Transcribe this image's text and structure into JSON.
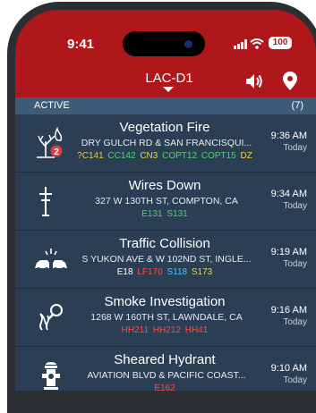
{
  "status_bar": {
    "time": "9:41",
    "battery": "100"
  },
  "header": {
    "channel": "LAC-D1"
  },
  "section": {
    "title": "ACTIVE",
    "count": "(7)"
  },
  "colors": {
    "header_red": "#b0171b",
    "list_bg": "#2a3f54",
    "section_bg": "#3e5c78"
  },
  "incidents": [
    {
      "icon": "vegetation-fire-icon",
      "badge": "2",
      "title": "Vegetation Fire",
      "address": "DRY GULCH RD & SAN FRANCISQUI...",
      "units": [
        {
          "id": "?C141",
          "color": "#f2c14e"
        },
        {
          "id": "CC142",
          "color": "#4ed36b"
        },
        {
          "id": "CN3",
          "color": "#f2d23a"
        },
        {
          "id": "COPT12",
          "color": "#4ed36b"
        },
        {
          "id": "COPT15",
          "color": "#4ed36b"
        },
        {
          "id": "DZ",
          "color": "#f2d23a"
        }
      ],
      "time": "9:36 AM",
      "day": "Today"
    },
    {
      "icon": "wires-down-icon",
      "title": "Wires Down",
      "address": "327 W 130TH ST, COMPTON, CA",
      "units": [
        {
          "id": "E131",
          "color": "#4ed36b"
        },
        {
          "id": "S131",
          "color": "#4ed36b"
        }
      ],
      "time": "9:34 AM",
      "day": "Today"
    },
    {
      "icon": "traffic-collision-icon",
      "title": "Traffic Collision",
      "address": "S YUKON AVE & W 102ND ST, INGLE...",
      "units": [
        {
          "id": "E18",
          "color": "#ffffff"
        },
        {
          "id": "LF170",
          "color": "#ff4b4b"
        },
        {
          "id": "S118",
          "color": "#4fc3f7"
        },
        {
          "id": "S173",
          "color": "#f2d23a"
        }
      ],
      "time": "9:19 AM",
      "day": "Today"
    },
    {
      "icon": "smoke-investigation-icon",
      "title": "Smoke Investigation",
      "address": "1268 W 160TH ST, LAWNDALE, CA",
      "units": [
        {
          "id": "HH211",
          "color": "#ff4b4b"
        },
        {
          "id": "HH212",
          "color": "#ff4b4b"
        },
        {
          "id": "HH41",
          "color": "#ff4b4b"
        }
      ],
      "time": "9:16 AM",
      "day": "Today"
    },
    {
      "icon": "fire-hydrant-icon",
      "title": "Sheared Hydrant",
      "address": "AVIATION BLVD & PACIFIC COAST...",
      "units": [
        {
          "id": "E162",
          "color": "#ff4b4b"
        }
      ],
      "time": "9:10 AM",
      "day": "Today"
    }
  ]
}
